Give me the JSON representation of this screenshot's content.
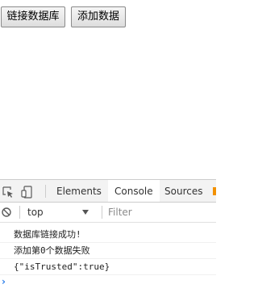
{
  "page": {
    "buttons": {
      "connect_db": "链接数据库",
      "add_data": "添加数据"
    }
  },
  "devtools": {
    "tabs": [
      "Elements",
      "Console",
      "Sources"
    ],
    "active_tab": "Console",
    "icons": {
      "inspect": "inspect-element-icon",
      "device": "device-toolbar-icon",
      "clear": "clear-console-icon",
      "more": "more-tabs-icon"
    },
    "toolbar": {
      "context": "top",
      "filter_placeholder": "Filter"
    },
    "console": {
      "messages": [
        "数据库链接成功!",
        "添加第0个数据失败",
        "{\"isTrusted\":true}"
      ],
      "prompt": "›"
    },
    "colors": {
      "accent": "#2b7de9",
      "more_indicator": "#f29100"
    }
  }
}
